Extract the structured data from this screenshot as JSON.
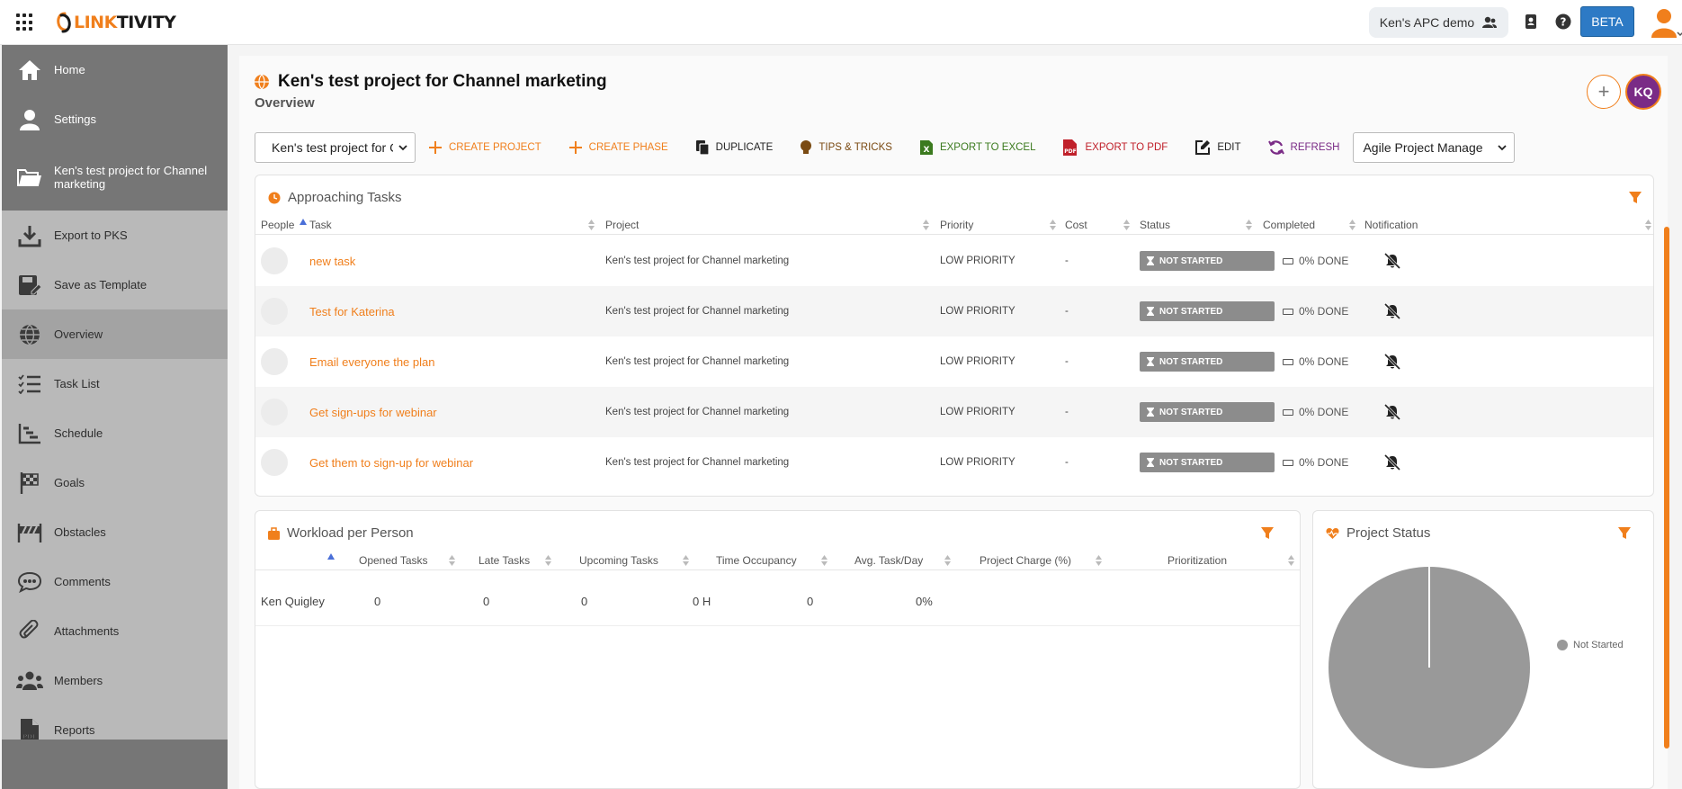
{
  "topbar": {
    "logo": {
      "prefix": "LINK",
      "suffix": "TIVITY"
    },
    "workspace": "Ken's APC demo",
    "beta": "BETA",
    "icons": [
      "apps-grid-icon",
      "contacts-icon",
      "help-icon",
      "user-avatar-icon"
    ]
  },
  "sidebar": {
    "items": [
      {
        "label": "Home",
        "icon": "home-icon"
      },
      {
        "label": "Settings",
        "icon": "user-icon"
      },
      {
        "label": "Ken's test project for Channel marketing",
        "icon": "folder-icon"
      },
      {
        "label": "Export to PKS",
        "icon": "download-icon"
      },
      {
        "label": "Save as Template",
        "icon": "save-template-icon"
      },
      {
        "label": "Overview",
        "icon": "globe-icon"
      },
      {
        "label": "Task List",
        "icon": "checklist-icon"
      },
      {
        "label": "Schedule",
        "icon": "gantt-icon"
      },
      {
        "label": "Goals",
        "icon": "finish-flag-icon"
      },
      {
        "label": "Obstacles",
        "icon": "barrier-icon"
      },
      {
        "label": "Comments",
        "icon": "comments-icon"
      },
      {
        "label": "Attachments",
        "icon": "paperclip-icon"
      },
      {
        "label": "Members",
        "icon": "members-icon"
      },
      {
        "label": "Reports",
        "icon": "pdf-icon"
      }
    ]
  },
  "header": {
    "title": "Ken's test project for Channel marketing",
    "subtitle": "Overview",
    "add_label": "+",
    "avatar_initials": "KQ"
  },
  "toolbar": {
    "project_select": "Ken's test project for C",
    "create_project": "CREATE PROJECT",
    "create_phase": "CREATE PHASE",
    "duplicate": "DUPLICATE",
    "tips": "TIPS & TRICKS",
    "export_excel": "EXPORT TO EXCEL",
    "export_pdf": "EXPORT TO PDF",
    "edit": "EDIT",
    "refresh": "REFRESH",
    "method_select": "Agile Project Manage",
    "colors": {
      "orange": "#f07f1c",
      "green": "#3b7a1e",
      "red": "#c0202a",
      "purple": "#7a2b86",
      "brown": "#7a4a12"
    }
  },
  "approaching": {
    "title": "Approaching Tasks",
    "columns": [
      "People",
      "Task",
      "Project",
      "Priority",
      "Cost",
      "Status",
      "Completed",
      "Notification"
    ],
    "rows": [
      {
        "task": "new task",
        "project": "Ken's test project for Channel marketing",
        "priority": "LOW PRIORITY",
        "cost": "-",
        "status": "NOT STARTED",
        "completed": "0% DONE"
      },
      {
        "task": "Test for Katerina",
        "project": "Ken's test project for Channel marketing",
        "priority": "LOW PRIORITY",
        "cost": "-",
        "status": "NOT STARTED",
        "completed": "0% DONE"
      },
      {
        "task": "Email everyone the plan",
        "project": "Ken's test project for Channel marketing",
        "priority": "LOW PRIORITY",
        "cost": "-",
        "status": "NOT STARTED",
        "completed": "0% DONE"
      },
      {
        "task": "Get sign-ups for webinar",
        "project": "Ken's test project for Channel marketing",
        "priority": "LOW PRIORITY",
        "cost": "-",
        "status": "NOT STARTED",
        "completed": "0% DONE"
      },
      {
        "task": "Get them to sign-up for webinar",
        "project": "Ken's test project for Channel marketing",
        "priority": "LOW PRIORITY",
        "cost": "-",
        "status": "NOT STARTED",
        "completed": "0% DONE"
      }
    ]
  },
  "workload": {
    "title": "Workload per Person",
    "columns": [
      "Opened Tasks",
      "Late Tasks",
      "Upcoming Tasks",
      "Time Occupancy",
      "Avg. Task/Day",
      "Project Charge (%)",
      "Prioritization"
    ],
    "rows": [
      {
        "name": "Ken Quigley",
        "opened": "0",
        "late": "0",
        "upcoming": "0",
        "occupancy": "0 H",
        "avg": "0",
        "charge": "0%",
        "prioritization": ""
      }
    ]
  },
  "project_status": {
    "title": "Project Status",
    "legend": "Not Started",
    "slice_color": "#999999"
  },
  "chart_data": {
    "type": "pie",
    "categories": [
      "Not Started"
    ],
    "values": [
      1
    ]
  }
}
